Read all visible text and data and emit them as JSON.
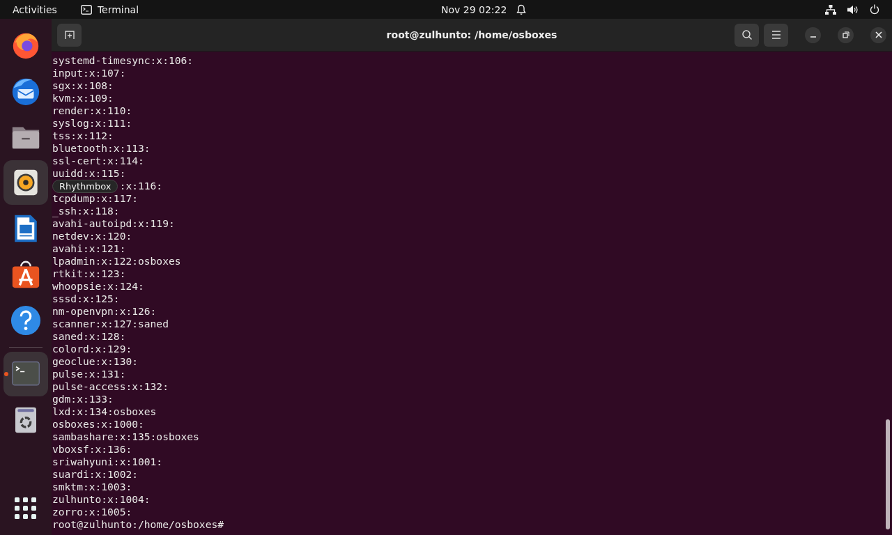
{
  "top_bar": {
    "activities": "Activities",
    "app_name": "Terminal",
    "clock": "Nov 29  02:22"
  },
  "dock": [
    {
      "kind": "firefox",
      "running": false,
      "highlighted": false
    },
    {
      "kind": "thunderbird",
      "running": false,
      "highlighted": false
    },
    {
      "kind": "files",
      "running": false,
      "highlighted": false
    },
    {
      "kind": "rhythmbox",
      "running": false,
      "highlighted": true
    },
    {
      "kind": "writer",
      "running": false,
      "highlighted": false
    },
    {
      "kind": "appcenter",
      "running": false,
      "highlighted": false
    },
    {
      "kind": "help",
      "running": false,
      "highlighted": false
    },
    {
      "kind": "separator"
    },
    {
      "kind": "terminal",
      "running": true,
      "highlighted": true
    },
    {
      "kind": "trash",
      "running": false,
      "highlighted": false
    },
    {
      "kind": "apps-grid",
      "running": false,
      "highlighted": false
    }
  ],
  "tooltip": "Rhythmbox",
  "window": {
    "title": "root@zulhunto: /home/osboxes"
  },
  "lines": [
    {
      "text": "systemd-timesync:x:106:",
      "kind": "plain"
    },
    {
      "text": "input:x:107:",
      "kind": "plain"
    },
    {
      "text": "sgx:x:108:",
      "kind": "plain"
    },
    {
      "text": "kvm:x:109:",
      "kind": "plain"
    },
    {
      "text": "render:x:110:",
      "kind": "plain"
    },
    {
      "text": "syslog:x:111:",
      "kind": "plain"
    },
    {
      "text": "tss:x:112:",
      "kind": "plain"
    },
    {
      "text": "bluetooth:x:113:",
      "kind": "plain"
    },
    {
      "text": "ssl-cert:x:114:",
      "kind": "plain"
    },
    {
      "text": "uuidd:x:115:",
      "kind": "plain"
    },
    {
      "text": ":x:116:",
      "kind": "covered"
    },
    {
      "text": "tcpdump:x:117:",
      "kind": "plain"
    },
    {
      "text": "_ssh:x:118:",
      "kind": "plain"
    },
    {
      "text": "avahi-autoipd:x:119:",
      "kind": "plain"
    },
    {
      "text": "netdev:x:120:",
      "kind": "plain"
    },
    {
      "text": "avahi:x:121:",
      "kind": "plain"
    },
    {
      "text": "lpadmin:x:122:osboxes",
      "kind": "plain"
    },
    {
      "text": "rtkit:x:123:",
      "kind": "plain"
    },
    {
      "text": "whoopsie:x:124:",
      "kind": "plain"
    },
    {
      "text": "sssd:x:125:",
      "kind": "plain"
    },
    {
      "text": "nm-openvpn:x:126:",
      "kind": "plain"
    },
    {
      "text": "scanner:x:127:saned",
      "kind": "plain"
    },
    {
      "text": "saned:x:128:",
      "kind": "plain"
    },
    {
      "text": "colord:x:129:",
      "kind": "plain"
    },
    {
      "text": "geoclue:x:130:",
      "kind": "plain"
    },
    {
      "text": "pulse:x:131:",
      "kind": "plain"
    },
    {
      "text": "pulse-access:x:132:",
      "kind": "plain"
    },
    {
      "text": "gdm:x:133:",
      "kind": "plain"
    },
    {
      "text": "lxd:x:134:osboxes",
      "kind": "plain"
    },
    {
      "text": "osboxes:x:1000:",
      "kind": "plain"
    },
    {
      "text": "sambashare:x:135:osboxes",
      "kind": "plain"
    },
    {
      "text": "vboxsf:x:136:",
      "kind": "plain"
    },
    {
      "text": "sriwahyuni:x:1001:",
      "kind": "plain"
    },
    {
      "text": "suardi:x:1002:",
      "kind": "plain"
    },
    {
      "text": "smktm:x:1003:",
      "kind": "plain"
    },
    {
      "text": "zulhunto:x:1004:",
      "kind": "plain"
    },
    {
      "text": "zorro:x:1005:",
      "kind": "plain"
    },
    {
      "text": "root@zulhunto:/home/osboxes#",
      "kind": "plain"
    }
  ]
}
